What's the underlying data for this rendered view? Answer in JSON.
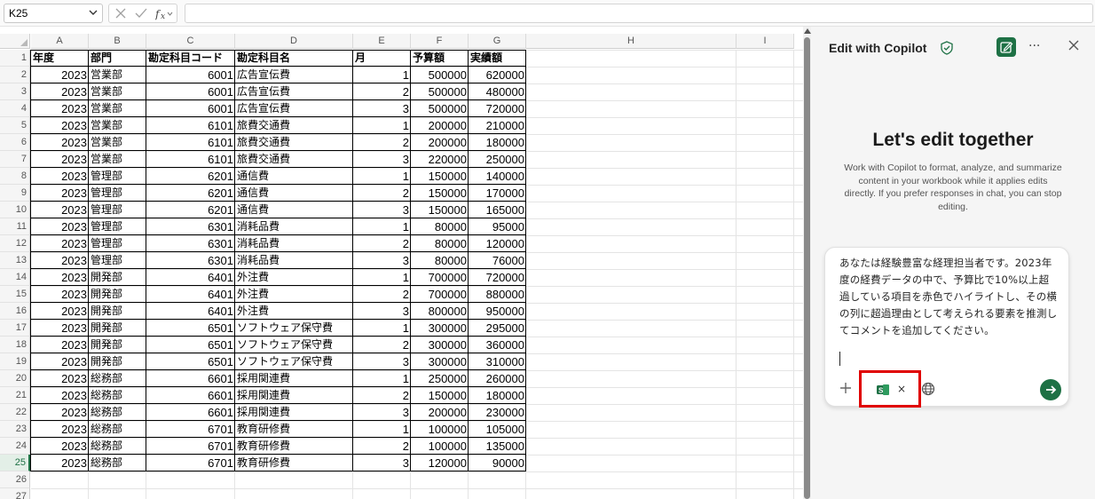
{
  "formula_bar": {
    "name_box": "K25",
    "function_icon": "fx-icon",
    "formula_value": ""
  },
  "sheet": {
    "columns": [
      "A",
      "B",
      "C",
      "D",
      "E",
      "F",
      "G",
      "H",
      "I"
    ],
    "row_numbers": [
      "1",
      "2",
      "3",
      "4",
      "5",
      "6",
      "7",
      "8",
      "9",
      "10",
      "11",
      "12",
      "13",
      "14",
      "15",
      "16",
      "17",
      "18",
      "19",
      "20",
      "21",
      "22",
      "23",
      "24",
      "25",
      "26",
      "27"
    ],
    "selected_row": "25",
    "headers": [
      "年度",
      "部門",
      "勘定科目コード",
      "勘定科目名",
      "月",
      "予算額",
      "実績額"
    ],
    "rows": [
      [
        "2023",
        "営業部",
        "6001",
        "広告宣伝費",
        "1",
        "500000",
        "620000"
      ],
      [
        "2023",
        "営業部",
        "6001",
        "広告宣伝費",
        "2",
        "500000",
        "480000"
      ],
      [
        "2023",
        "営業部",
        "6001",
        "広告宣伝費",
        "3",
        "500000",
        "720000"
      ],
      [
        "2023",
        "営業部",
        "6101",
        "旅費交通費",
        "1",
        "200000",
        "210000"
      ],
      [
        "2023",
        "営業部",
        "6101",
        "旅費交通費",
        "2",
        "200000",
        "180000"
      ],
      [
        "2023",
        "営業部",
        "6101",
        "旅費交通費",
        "3",
        "220000",
        "250000"
      ],
      [
        "2023",
        "管理部",
        "6201",
        "通信費",
        "1",
        "150000",
        "140000"
      ],
      [
        "2023",
        "管理部",
        "6201",
        "通信費",
        "2",
        "150000",
        "170000"
      ],
      [
        "2023",
        "管理部",
        "6201",
        "通信費",
        "3",
        "150000",
        "165000"
      ],
      [
        "2023",
        "管理部",
        "6301",
        "消耗品費",
        "1",
        "80000",
        "95000"
      ],
      [
        "2023",
        "管理部",
        "6301",
        "消耗品費",
        "2",
        "80000",
        "120000"
      ],
      [
        "2023",
        "管理部",
        "6301",
        "消耗品費",
        "3",
        "80000",
        "76000"
      ],
      [
        "2023",
        "開発部",
        "6401",
        "外注費",
        "1",
        "700000",
        "720000"
      ],
      [
        "2023",
        "開発部",
        "6401",
        "外注費",
        "2",
        "700000",
        "880000"
      ],
      [
        "2023",
        "開発部",
        "6401",
        "外注費",
        "3",
        "800000",
        "950000"
      ],
      [
        "2023",
        "開発部",
        "6501",
        "ソフトウェア保守費",
        "1",
        "300000",
        "295000"
      ],
      [
        "2023",
        "開発部",
        "6501",
        "ソフトウェア保守費",
        "2",
        "300000",
        "360000"
      ],
      [
        "2023",
        "開発部",
        "6501",
        "ソフトウェア保守費",
        "3",
        "300000",
        "310000"
      ],
      [
        "2023",
        "総務部",
        "6601",
        "採用関連費",
        "1",
        "250000",
        "260000"
      ],
      [
        "2023",
        "総務部",
        "6601",
        "採用関連費",
        "2",
        "150000",
        "180000"
      ],
      [
        "2023",
        "総務部",
        "6601",
        "採用関連費",
        "3",
        "200000",
        "230000"
      ],
      [
        "2023",
        "総務部",
        "6701",
        "教育研修費",
        "1",
        "100000",
        "105000"
      ],
      [
        "2023",
        "総務部",
        "6701",
        "教育研修費",
        "2",
        "100000",
        "135000"
      ],
      [
        "2023",
        "総務部",
        "6701",
        "教育研修費",
        "3",
        "120000",
        "90000"
      ]
    ]
  },
  "copilot": {
    "title": "Edit with Copilot",
    "hero_title": "Let's edit together",
    "hero_desc": "Work with Copilot to format, analyze, and summarize content in your workbook while it applies edits directly. If you prefer responses in chat, you can stop editing.",
    "prompt_text": "あなたは経験豊富な経理担当者です。2023年度の経費データの中で、予算比で10%以上超過している項目を赤色でハイライトし、その横の列に超過理由として考えられる要素を推測してコメントを追加してください。",
    "attachment_remove": "×",
    "more_label": "···",
    "colors": {
      "accent": "#1e7145",
      "highlight_box": "#e00000"
    }
  }
}
